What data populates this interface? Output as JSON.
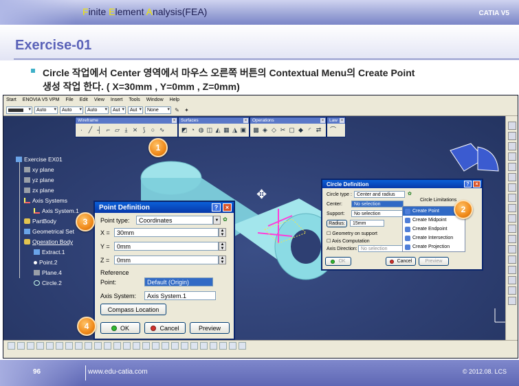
{
  "slide": {
    "header_title_parts": [
      "F",
      "inite ",
      "E",
      "lement ",
      "A",
      "nalysis(FEA)"
    ],
    "brand": "CATIA V5",
    "exercise_title": "Exercise-01",
    "instruction_line1": "Circle 작업에서 Center 영역에서 마우스 오른쪽 버튼의 Contextual Menu의 Create Point",
    "instruction_line2": "생성 작업 한다. ( X=30mm , Y=0mm , Z=0mm)",
    "page_number": "96",
    "website": "www.edu-catia.com",
    "copyright": "© 2012.08. LCS"
  },
  "menubar": {
    "items": [
      "Start",
      "ENOVIA V5 VPM",
      "File",
      "Edit",
      "View",
      "Insert",
      "Tools",
      "Window",
      "Help"
    ]
  },
  "propbar": {
    "combos": [
      "Auto",
      "Auto",
      "Auto",
      "Aut",
      "Aut",
      "None"
    ]
  },
  "floating_toolbars": {
    "wireframe": "Wireframe",
    "surfaces": "Surfaces",
    "operations": "Operations",
    "law": "Law"
  },
  "tree": {
    "root": "Exercise EX01",
    "xy_plane": "xy plane",
    "yz_plane": "yz plane",
    "zx_plane": "zx plane",
    "axis_systems": "Axis Systems",
    "axis_system_1": "Axis System.1",
    "part_body": "PartBody",
    "geometrical_set": "Geometrical Set",
    "operation_body": "Operation Body",
    "extract_1": "Extract.1",
    "point_2": "Point.2",
    "plane_4": "Plane.4",
    "circle_2": "Circle.2"
  },
  "point_definition": {
    "title": "Point Definition",
    "point_type_label": "Point type:",
    "point_type_value": "Coordinates",
    "x_label": "X =",
    "x_value": "30mm",
    "y_label": "Y =",
    "y_value": "0mm",
    "z_label": "Z =",
    "z_value": "0mm",
    "reference_label": "Reference",
    "point_label": "Point:",
    "point_value": "Default (Origin)",
    "axis_system_label": "Axis System:",
    "axis_system_value": "Axis System.1",
    "compass_button": "Compass Location",
    "ok_button": "OK",
    "cancel_button": "Cancel",
    "preview_button": "Preview"
  },
  "circle_definition": {
    "title": "Circle Definition",
    "circle_type_label": "Circle type :",
    "circle_type_value": "Center and radius",
    "center_label": "Center:",
    "center_value": "No selection",
    "support_label": "Support:",
    "support_value": "No selection",
    "radius_button": "Radius:",
    "radius_value": "15mm",
    "circle_limitations": "Circle Limitations",
    "geometry_on_support": "Geometry on support",
    "axis_computation": "Axis Computation",
    "axis_direction_label": "Axis Direction:",
    "axis_direction_value": "No selection",
    "ok_button": "OK",
    "cancel_button": "Cancel",
    "preview_button": "Preview"
  },
  "context_menu": {
    "items": [
      "Create Point",
      "Create Midpoint",
      "Create Endpoint",
      "Create Intersection",
      "Create Projection"
    ]
  },
  "steps": [
    "1",
    "2",
    "3",
    "4"
  ],
  "colors": {
    "viewport_bg": "#2e3f72",
    "title_accent": "#5a62b8",
    "step_badge": "#f08a1a",
    "part_cyan": "#7fd6e0",
    "window_title": "#0a5fd8"
  }
}
